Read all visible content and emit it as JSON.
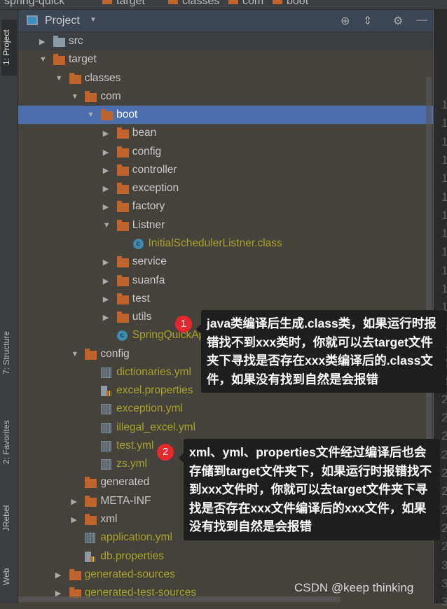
{
  "breadcrumb": [
    "spring-quick",
    "target",
    "classes",
    "com",
    "boot"
  ],
  "side_tabs": [
    "1: Project",
    "7: Structure",
    "2: Favorites",
    "JRebel",
    "Web"
  ],
  "header": {
    "title": "Project",
    "icons": [
      "locate-icon",
      "collapse-all-icon",
      "gear-icon",
      "minimize-icon"
    ]
  },
  "tree": [
    {
      "label": "src",
      "level": 0,
      "type": "folder",
      "expanded": false,
      "folder_color": "grey"
    },
    {
      "label": "target",
      "level": 0,
      "type": "folder",
      "expanded": true
    },
    {
      "label": "classes",
      "level": 1,
      "type": "folder",
      "expanded": true
    },
    {
      "label": "com",
      "level": 2,
      "type": "folder",
      "expanded": true
    },
    {
      "label": "boot",
      "level": 3,
      "type": "folder",
      "expanded": true,
      "selected": true
    },
    {
      "label": "bean",
      "level": 4,
      "type": "folder",
      "expanded": false
    },
    {
      "label": "config",
      "level": 4,
      "type": "folder",
      "expanded": false
    },
    {
      "label": "controller",
      "level": 4,
      "type": "folder",
      "expanded": false
    },
    {
      "label": "exception",
      "level": 4,
      "type": "folder",
      "expanded": false
    },
    {
      "label": "factory",
      "level": 4,
      "type": "folder",
      "expanded": false
    },
    {
      "label": "Listner",
      "level": 4,
      "type": "folder",
      "expanded": true
    },
    {
      "label": "InitialSchedulerListner.class",
      "level": 5,
      "type": "class"
    },
    {
      "label": "service",
      "level": 4,
      "type": "folder",
      "expanded": false
    },
    {
      "label": "suanfa",
      "level": 4,
      "type": "folder",
      "expanded": false
    },
    {
      "label": "test",
      "level": 4,
      "type": "folder",
      "expanded": false
    },
    {
      "label": "utils",
      "level": 4,
      "type": "folder",
      "expanded": false
    },
    {
      "label": "SpringQuickApplication.class",
      "level": 4,
      "type": "class"
    },
    {
      "label": "config",
      "level": 2,
      "type": "folder",
      "expanded": true
    },
    {
      "label": "dictionaries.yml",
      "level": 3,
      "type": "yml"
    },
    {
      "label": "excel.properties",
      "level": 3,
      "type": "props"
    },
    {
      "label": "exception.yml",
      "level": 3,
      "type": "yml"
    },
    {
      "label": "illegal_excel.yml",
      "level": 3,
      "type": "yml"
    },
    {
      "label": "test.yml",
      "level": 3,
      "type": "yml"
    },
    {
      "label": "zs.yml",
      "level": 3,
      "type": "yml"
    },
    {
      "label": "generated",
      "level": 2,
      "type": "folder",
      "leaf": true
    },
    {
      "label": "META-INF",
      "level": 2,
      "type": "folder",
      "expanded": false
    },
    {
      "label": "xml",
      "level": 2,
      "type": "folder",
      "expanded": false
    },
    {
      "label": "application.yml",
      "level": 2,
      "type": "yml"
    },
    {
      "label": "db.properties",
      "level": 2,
      "type": "props"
    },
    {
      "label": "generated-sources",
      "level": 1,
      "type": "folder",
      "expanded": false,
      "excluded": true
    },
    {
      "label": "generated-test-sources",
      "level": 1,
      "type": "folder",
      "expanded": false,
      "excluded": true
    }
  ],
  "gutter_numbers": [
    "1",
    "1",
    "1",
    "1",
    "1",
    "1",
    "1",
    "1",
    "1",
    "1",
    "1",
    "1",
    "1",
    "1",
    "2",
    "2",
    "2",
    "2",
    "2",
    "2",
    "2",
    "2",
    "2",
    "2",
    "2",
    "3",
    "3",
    "3"
  ],
  "annotations": [
    {
      "badge": "1",
      "text": "java类编译后生成.class类，如果运行时报错找不到xxx类时，你就可以去target文件夹下寻找是否存在xxx类编译后的.class文件，如果没有找到自然是会报错"
    },
    {
      "badge": "2",
      "text": "xml、yml、properties文件经过编译后也会存储到target文件夹下，如果运行时报错找不到xxx文件时，你就可以去target文件夹下寻找是否存在xxx文件编译后的xxx文件，如果没有找到自然是会报错"
    }
  ],
  "watermark": "CSDN @keep   thinking",
  "colors": {
    "selected": "#4b6eaf",
    "folder": "#c0642b",
    "excluded_text": "#a6a32b",
    "tooltip": "#1e1e1e",
    "badge": "#e8262b"
  }
}
